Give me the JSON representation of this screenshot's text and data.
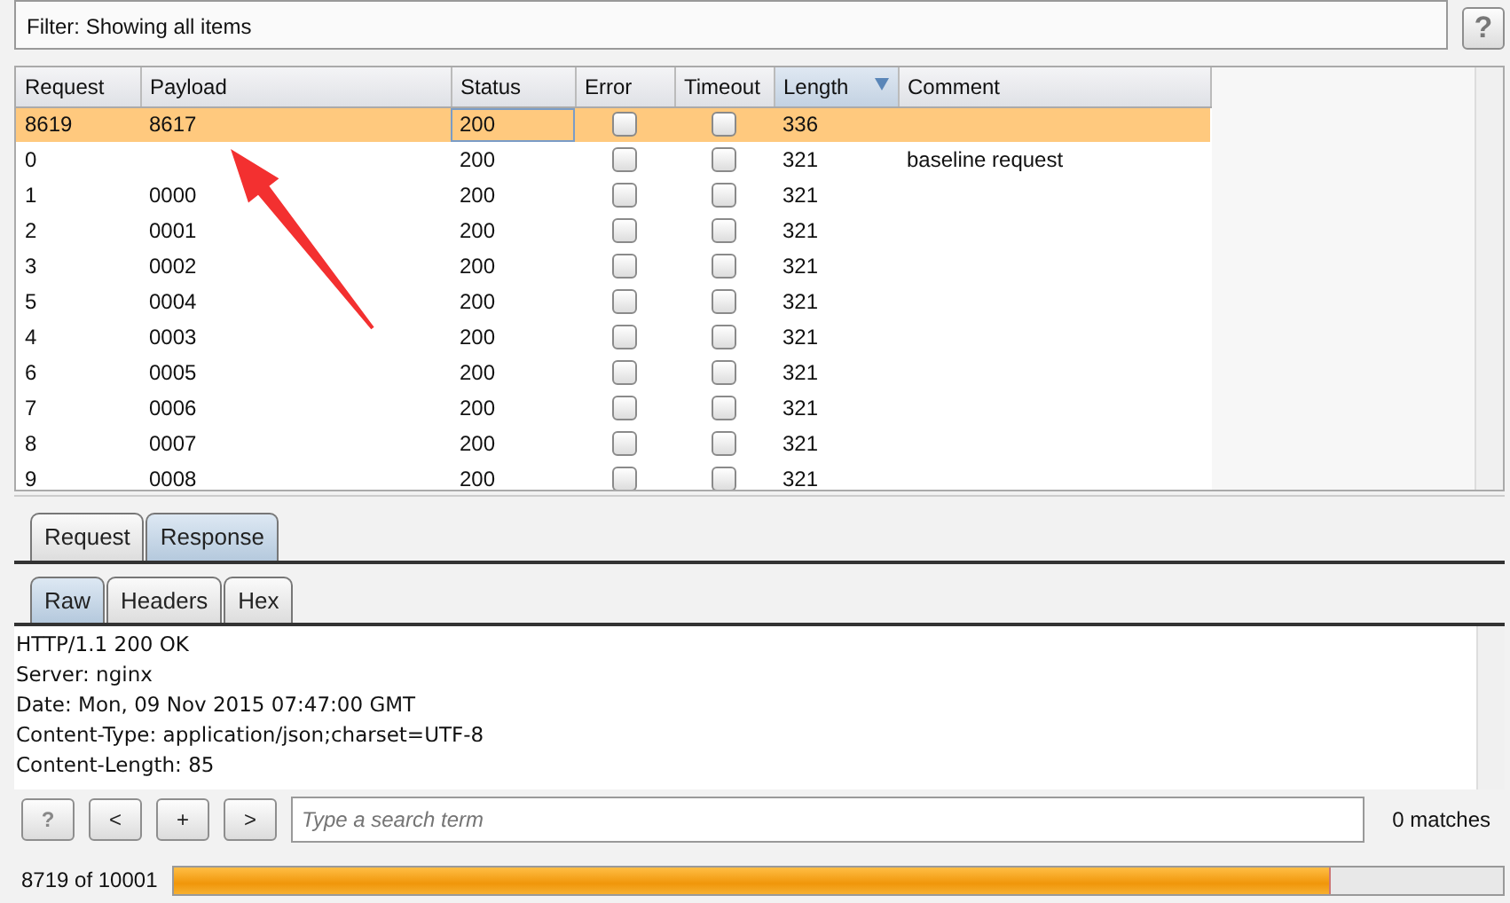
{
  "filter": {
    "text": "Filter: Showing all items"
  },
  "help_button": {
    "label": "?"
  },
  "table": {
    "columns": [
      {
        "label": "Request",
        "sorted": false
      },
      {
        "label": "Payload",
        "sorted": false
      },
      {
        "label": "Status",
        "sorted": false
      },
      {
        "label": "Error",
        "sorted": false
      },
      {
        "label": "Timeout",
        "sorted": false
      },
      {
        "label": "Length",
        "sorted": true
      },
      {
        "label": "Comment",
        "sorted": false
      }
    ],
    "rows": [
      {
        "request": "8619",
        "payload": "8617",
        "status": "200",
        "error": false,
        "timeout": false,
        "length": "336",
        "selected": true
      },
      {
        "request": "0",
        "status": "200",
        "error": false,
        "timeout": false,
        "length": "321",
        "comment": "baseline request",
        "selected": false
      },
      {
        "request": "1",
        "payload": "0000",
        "status": "200",
        "error": false,
        "timeout": false,
        "length": "321",
        "selected": false
      },
      {
        "request": "2",
        "payload": "0001",
        "status": "200",
        "error": false,
        "timeout": false,
        "length": "321",
        "selected": false
      },
      {
        "request": "3",
        "payload": "0002",
        "status": "200",
        "error": false,
        "timeout": false,
        "length": "321",
        "selected": false
      },
      {
        "request": "5",
        "payload": "0004",
        "status": "200",
        "error": false,
        "timeout": false,
        "length": "321",
        "selected": false
      },
      {
        "request": "4",
        "payload": "0003",
        "status": "200",
        "error": false,
        "timeout": false,
        "length": "321",
        "selected": false
      },
      {
        "request": "6",
        "payload": "0005",
        "status": "200",
        "error": false,
        "timeout": false,
        "length": "321",
        "selected": false
      },
      {
        "request": "7",
        "payload": "0006",
        "status": "200",
        "error": false,
        "timeout": false,
        "length": "321",
        "selected": false
      },
      {
        "request": "8",
        "payload": "0007",
        "status": "200",
        "error": false,
        "timeout": false,
        "length": "321",
        "selected": false
      },
      {
        "request": "9",
        "payload": "0008",
        "status": "200",
        "error": false,
        "timeout": false,
        "length": "321",
        "selected": false
      }
    ]
  },
  "message_tabs": [
    {
      "label": "Request",
      "selected": false
    },
    {
      "label": "Response",
      "selected": true
    }
  ],
  "view_tabs": [
    {
      "label": "Raw",
      "selected": true
    },
    {
      "label": "Headers",
      "selected": false
    },
    {
      "label": "Hex",
      "selected": false
    }
  ],
  "response_lines": [
    "HTTP/1.1 200 OK",
    "Server: nginx",
    "Date: Mon, 09 Nov 2015 07:47:00 GMT",
    "Content-Type: application/json;charset=UTF-8",
    "Content-Length: 85"
  ],
  "search": {
    "buttons": [
      "?",
      "<",
      "+",
      ">"
    ],
    "placeholder": "Type a search term",
    "matches": "0 matches"
  },
  "progress": {
    "text": "8719 of 10001",
    "level": 0.87
  }
}
